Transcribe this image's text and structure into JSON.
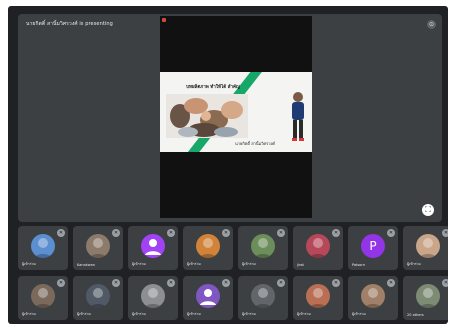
{
  "stage": {
    "presenter_label": "นายกิตติ์ สานิ้มวิศรวงศ์ is presenting",
    "slide": {
      "title": "บทผลิตภาพ ทำให้ได้ สำคัญ",
      "author": "นายกิตติ์ สานิ้มวิศรวงศ์"
    },
    "accent_color": "#17a869"
  },
  "participants": [
    {
      "name": "ผู้เข้าร่วม",
      "avatar": "photo",
      "avatar_color": "#5b8fcf",
      "initial": ""
    },
    {
      "name": "Kanokwan",
      "avatar": "photo",
      "avatar_color": "#8c7a6a",
      "initial": ""
    },
    {
      "name": "ผู้เข้าร่วม",
      "avatar": "default",
      "avatar_color": "#a142f4",
      "initial": ""
    },
    {
      "name": "ผู้เข้าร่วม",
      "avatar": "photo",
      "avatar_color": "#d1833a",
      "initial": ""
    },
    {
      "name": "ผู้เข้าร่วม",
      "avatar": "photo",
      "avatar_color": "#6b8e5a",
      "initial": ""
    },
    {
      "name": "jirat",
      "avatar": "photo",
      "avatar_color": "#b7485a",
      "initial": ""
    },
    {
      "name": "Patsorn",
      "avatar": "letter",
      "avatar_color": "#9334e6",
      "initial": "P"
    },
    {
      "name": "ผู้เข้าร่วม",
      "avatar": "photo",
      "avatar_color": "#c9a58a",
      "initial": ""
    },
    {
      "name": "ผู้เข้าร่วม",
      "avatar": "photo",
      "avatar_color": "#7b6a5c",
      "initial": ""
    },
    {
      "name": "ผู้เข้าร่วม",
      "avatar": "photo",
      "avatar_color": "#4f5a66",
      "initial": ""
    },
    {
      "name": "ผู้เข้าร่วม",
      "avatar": "photo",
      "avatar_color": "#8d8f93",
      "initial": ""
    },
    {
      "name": "ผู้เข้าร่วม",
      "avatar": "default",
      "avatar_color": "#7e57c2",
      "initial": ""
    },
    {
      "name": "ผู้เข้าร่วม",
      "avatar": "photo",
      "avatar_color": "#62666b",
      "initial": ""
    },
    {
      "name": "ผู้เข้าร่วม",
      "avatar": "photo",
      "avatar_color": "#b86f54",
      "initial": ""
    },
    {
      "name": "ผู้เข้าร่วม",
      "avatar": "photo",
      "avatar_color": "#a08068",
      "initial": ""
    },
    {
      "name": "20 others",
      "avatar": "photo",
      "avatar_color": "#7e8b74",
      "initial": ""
    }
  ]
}
